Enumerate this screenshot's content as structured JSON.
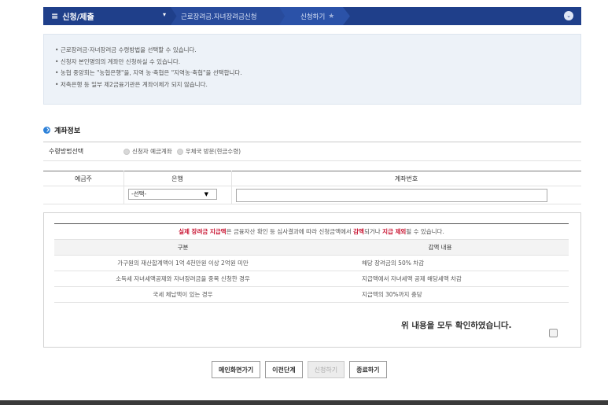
{
  "nav": {
    "menu_label": "신청/제출",
    "crumb1": "근로장려금.자녀장려금신청",
    "crumb2": "신청하기",
    "star": "★",
    "dropdown": "▾",
    "circle": "⌄"
  },
  "notice": {
    "items": [
      "근로장려금·자녀장려금 수령방법을 선택할 수 있습니다.",
      "신청자 본인명의의 계좌만 신청하실 수 있습니다.",
      "농협 중앙회는 \"농협은행\"을, 지역 농·축협은 \"지역농·축협\"을 선택합니다.",
      "저축은행 등 일부 제2금융기관은 계좌이체가 되지 않습니다."
    ]
  },
  "account": {
    "title": "계좌정보",
    "method_label": "수령방법선택",
    "option1": "신청자 예금계좌",
    "option2": "우체국 방문(현금수령)",
    "col_holder": "예금주",
    "col_bank": "은행",
    "col_number": "계좌번호",
    "bank_select_value": "-선택-"
  },
  "deduction": {
    "note_red1": "실제 장려금 지급액",
    "note_mid1": "은 금융자산 확인 등 심사결과에 따라 신청금액에서 ",
    "note_red2": "감액",
    "note_mid2": "되거나 ",
    "note_red3": "지급 제외",
    "note_end": "될 수 있습니다.",
    "head_c1": "구분",
    "head_c2": "감액 내용",
    "rows": [
      {
        "c1": "가구원의 재산합계액이 1억 4천만원 이상 2억원 미만",
        "c2": "해당 장려금의 50% 차감"
      },
      {
        "c1": "소득세 자녀세액공제와 자녀장려금을 중복 신청한 경우",
        "c2": "지급액에서 자녀세액 공제 해당세액 차감"
      },
      {
        "c1": "국세 체납액이 있는 경우",
        "c2": "지급액의 30%까지 충당"
      }
    ],
    "confirm": "위 내용을 모두 확인하였습니다."
  },
  "buttons": {
    "main": "메인화면가기",
    "prev": "이전단계",
    "apply": "신청하기",
    "end": "종료하기"
  }
}
